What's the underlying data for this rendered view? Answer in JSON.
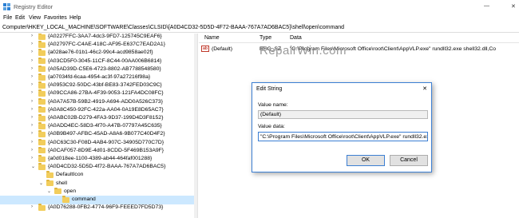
{
  "window": {
    "title": "Registry Editor",
    "minimize": "—",
    "close": "✕"
  },
  "menu": [
    "File",
    "Edit",
    "View",
    "Favorites",
    "Help"
  ],
  "address": "Computer\\HKEY_LOCAL_MACHINE\\SOFTWARE\\Classes\\CLSID\\{A0D4CD32-5D5D-4F72-BAAA-767A7AD6BAC5}\\shell\\open\\command",
  "tree": [
    "{A0227FFC-3AA7-4dc3-9FD7-125745C9EAF6}",
    "{A02797FC-C4AE-418C-AF95-E637C7EAD2A1}",
    "{a028ae76-01b1-46c2-99c4-acd9858ae02f}",
    "{A03CD5F0-3045-11CF-8C44-00AA006B6814}",
    "{A05AD39D-C5E6-4723-8802-AB7788548580}",
    "{a07034fd-6caa-4954-ac3f-97a27216f98a}",
    "{A0953C92-50DC-43bf-BE83-3742FED03C9C}",
    "{A09CCA86-27BA-4F39-9053-121FA4DC08FC}",
    "{A0A7A57B-59B2-4919-A694-ADD0A526C373}",
    "{A0A8C450-92FC-422a-AA04-0A19E8D65AC7}",
    "{A0ABC02B-D279-4FA3-9D37-199D4D3F8152}",
    "{A0ADD4EC-58D3-4f70-A47B-07797A45C635}",
    "{A0B9B497-AFBC-45AD-A8A6-9B077C40D4F2}",
    "{A0C63C30-F08D-4AB4-907C-34905D770C7D}",
    "{A0CAF057-8D9E-4d01-8CDD-5F469B153A9F}",
    "{a0d018ee-1100-4389-ab44-464faf001288}",
    "{A0D4CD32-5D5D-4f72-BAAA-767A7AD6BAC5}",
    "DefaultIcon",
    "shell",
    "open",
    "command",
    "{A0D76288-0FB2-4774-96F9-FEEED7FD5D73}"
  ],
  "list": {
    "headers": [
      "Name",
      "Type",
      "Data"
    ],
    "row": {
      "name": "(Default)",
      "type": "REG_SZ",
      "data": "\"C:\\Program Files\\Microsoft Office\\root\\Client\\AppVLP.exe\" rundll32.exe shell32.dll,Co"
    },
    "icon_text": "ab"
  },
  "dialog": {
    "title": "Edit String",
    "close": "✕",
    "value_name_label": "Value name:",
    "value_name": "(Default)",
    "value_data_label": "Value data:",
    "value_data": "\"C:\\Program Files\\Microsoft Office\\root\\Client\\AppVLP.exe\" rundll32.exe sl",
    "ok": "OK",
    "cancel": "Cancel"
  },
  "watermark": "RepairWin.com"
}
